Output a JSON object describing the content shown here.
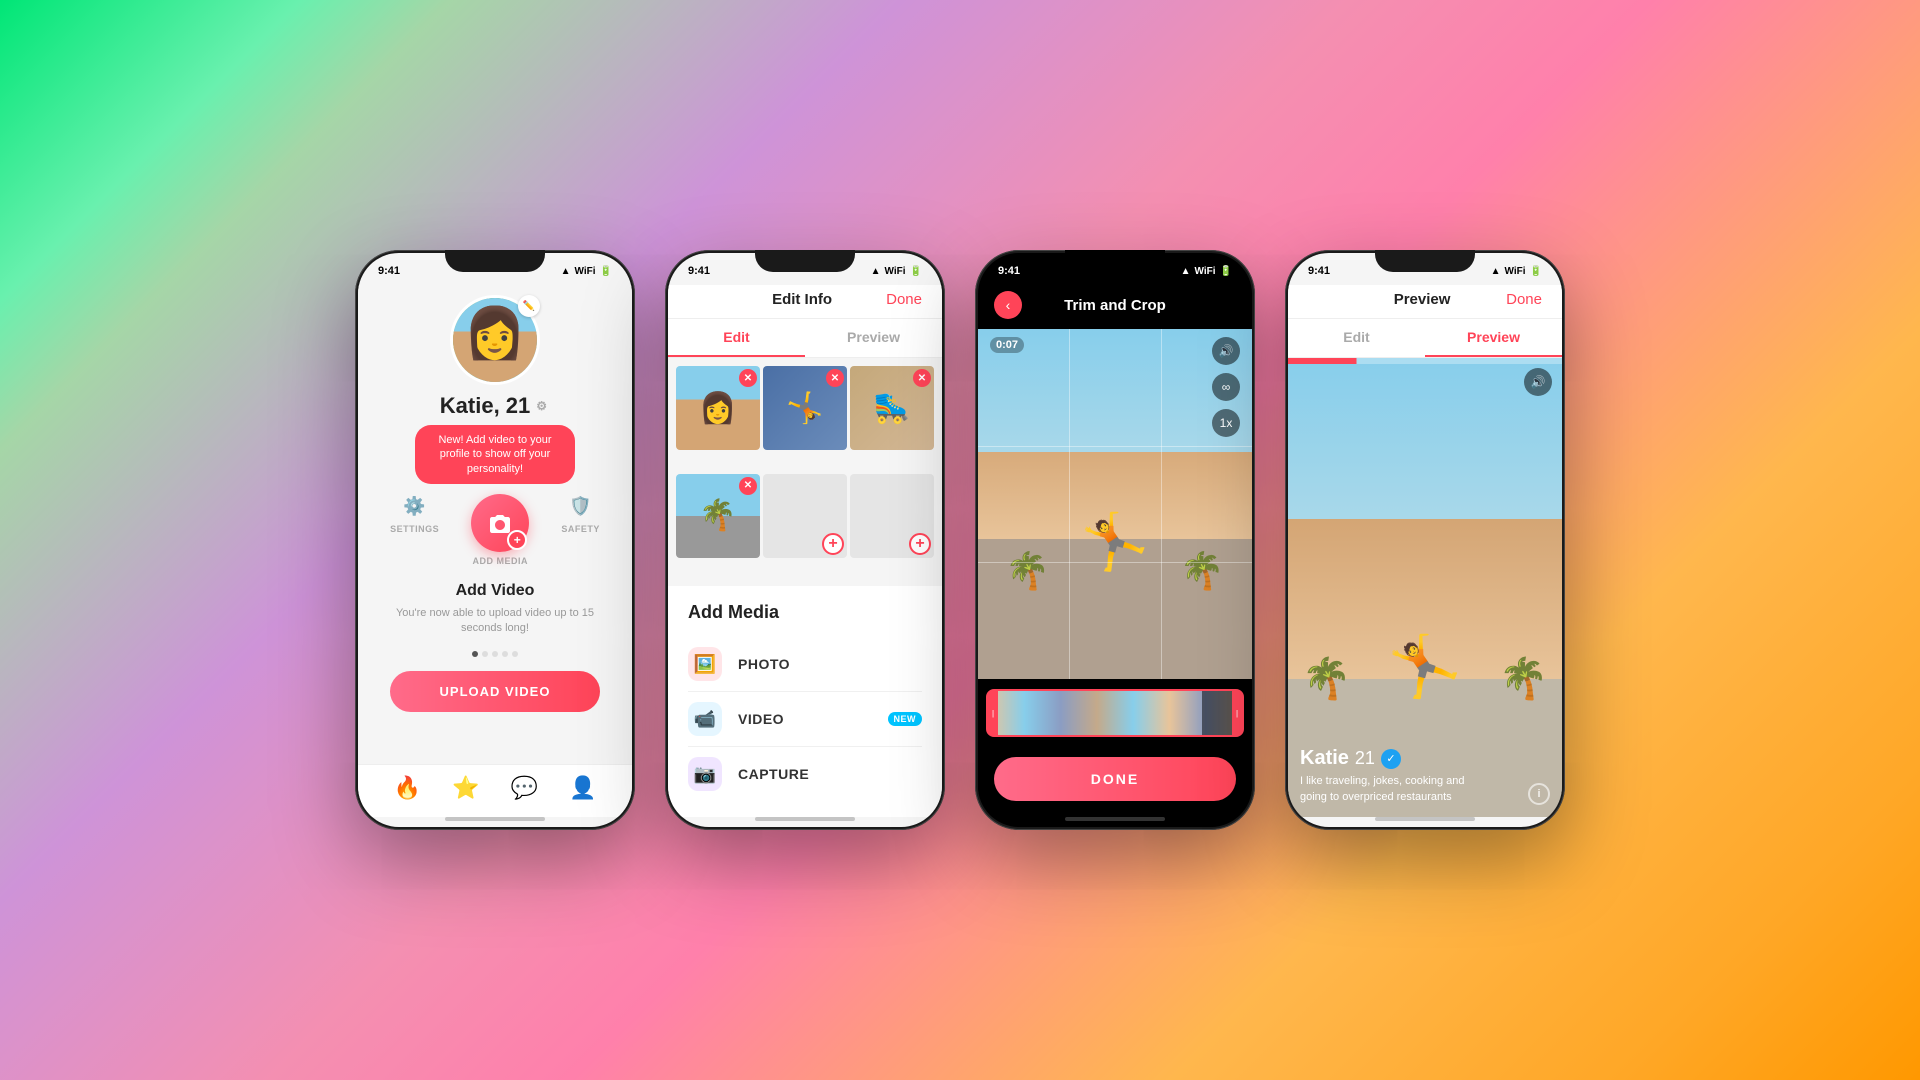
{
  "background": "linear-gradient(135deg, #00e676 0%, #69f0ae 10%, #ce93d8 35%, #f48fb1 50%, #ffb74d 75%, #ff9800 100%)",
  "phones": [
    {
      "id": "phone1",
      "statusBar": {
        "time": "9:41",
        "signal": "●●●",
        "wifi": "▲",
        "battery": "■"
      },
      "user": {
        "name": "Katie,",
        "age": "21"
      },
      "tooltip": "New! Add video to your profile to show off your personality!",
      "actions": [
        "SETTINGS",
        "SAFETY"
      ],
      "addMediaLabel": "ADD MEDIA",
      "addVideoTitle": "Add Video",
      "addVideoDesc": "You're now able to upload video up to 15 seconds long!",
      "uploadBtn": "UPLOAD VIDEO",
      "bottomNav": [
        "🔥",
        "⭐",
        "💬",
        "👤"
      ]
    },
    {
      "id": "phone2",
      "statusBar": {
        "time": "9:41"
      },
      "header": {
        "title": "Edit Info",
        "done": "Done"
      },
      "tabs": [
        "Edit",
        "Preview"
      ],
      "activeTab": 0,
      "addMediaTitle": "Add Media",
      "mediaOptions": [
        {
          "label": "PHOTO",
          "icon": "🖼",
          "colorClass": "photo-icon-bg",
          "badge": null
        },
        {
          "label": "VIDEO",
          "icon": "📹",
          "colorClass": "video-icon-bg",
          "badge": "NEW"
        },
        {
          "label": "CAPTURE",
          "icon": "📷",
          "colorClass": "capture-icon-bg",
          "badge": null
        }
      ]
    },
    {
      "id": "phone3",
      "statusBar": {
        "time": "9:41"
      },
      "header": {
        "title": "Trim and Crop"
      },
      "videoTime": "0:07",
      "speedLabel": "1x",
      "doneBtn": "DONE"
    },
    {
      "id": "phone4",
      "statusBar": {
        "time": "9:41"
      },
      "header": {
        "title": "Preview",
        "done": "Done"
      },
      "tabs": [
        "Edit",
        "Preview"
      ],
      "activeTab": 1,
      "user": {
        "name": "Katie",
        "age": "21",
        "bio": "I like traveling, jokes, cooking and going to overpriced restaurants"
      }
    }
  ]
}
